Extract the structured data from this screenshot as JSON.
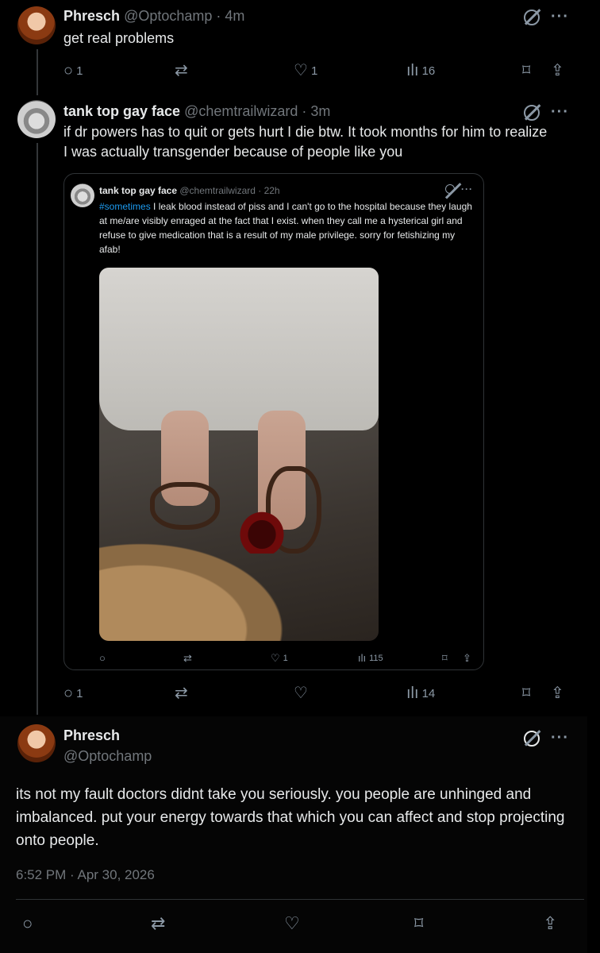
{
  "tweet1": {
    "name": "Phresch",
    "handle": "@Optochamp · 4m",
    "text": "get real problems",
    "replies": "1",
    "likes": "1",
    "views": "16"
  },
  "tweet2": {
    "name": "tank top gay face",
    "handle": "@chemtrailwizard · 3m",
    "text": "if dr powers has to quit or gets hurt I die btw. It took months for him to realize I was actually transgender because of people like you",
    "replies": "1",
    "views": "14"
  },
  "quote": {
    "name": "tank top gay face",
    "handle": "@chemtrailwizard · 22h",
    "hashtag": "#sometimes",
    "text": " I leak blood instead of piss and I can't go to the hospital because they laugh at me/are visibly enraged at the fact that I exist. when they call me a hysterical girl and refuse to give medication that is a result of my male privilege. sorry for fetishizing my afab!",
    "likes": "1",
    "views": "115"
  },
  "main": {
    "name": "Phresch",
    "handle": "@Optochamp",
    "text": "its not my fault doctors didnt take you seriously. you people are unhinged and imbalanced. put your energy towards that which you can affect and stop projecting onto people.",
    "timestamp": "6:52 PM · Apr 30, 2026"
  },
  "icons": {
    "reply": "reply-icon",
    "retweet": "retweet-icon",
    "like": "heart-icon",
    "views": "views-icon",
    "bookmark": "bookmark-icon",
    "share": "share-icon",
    "grok": "grok-icon",
    "more": "more-icon"
  }
}
